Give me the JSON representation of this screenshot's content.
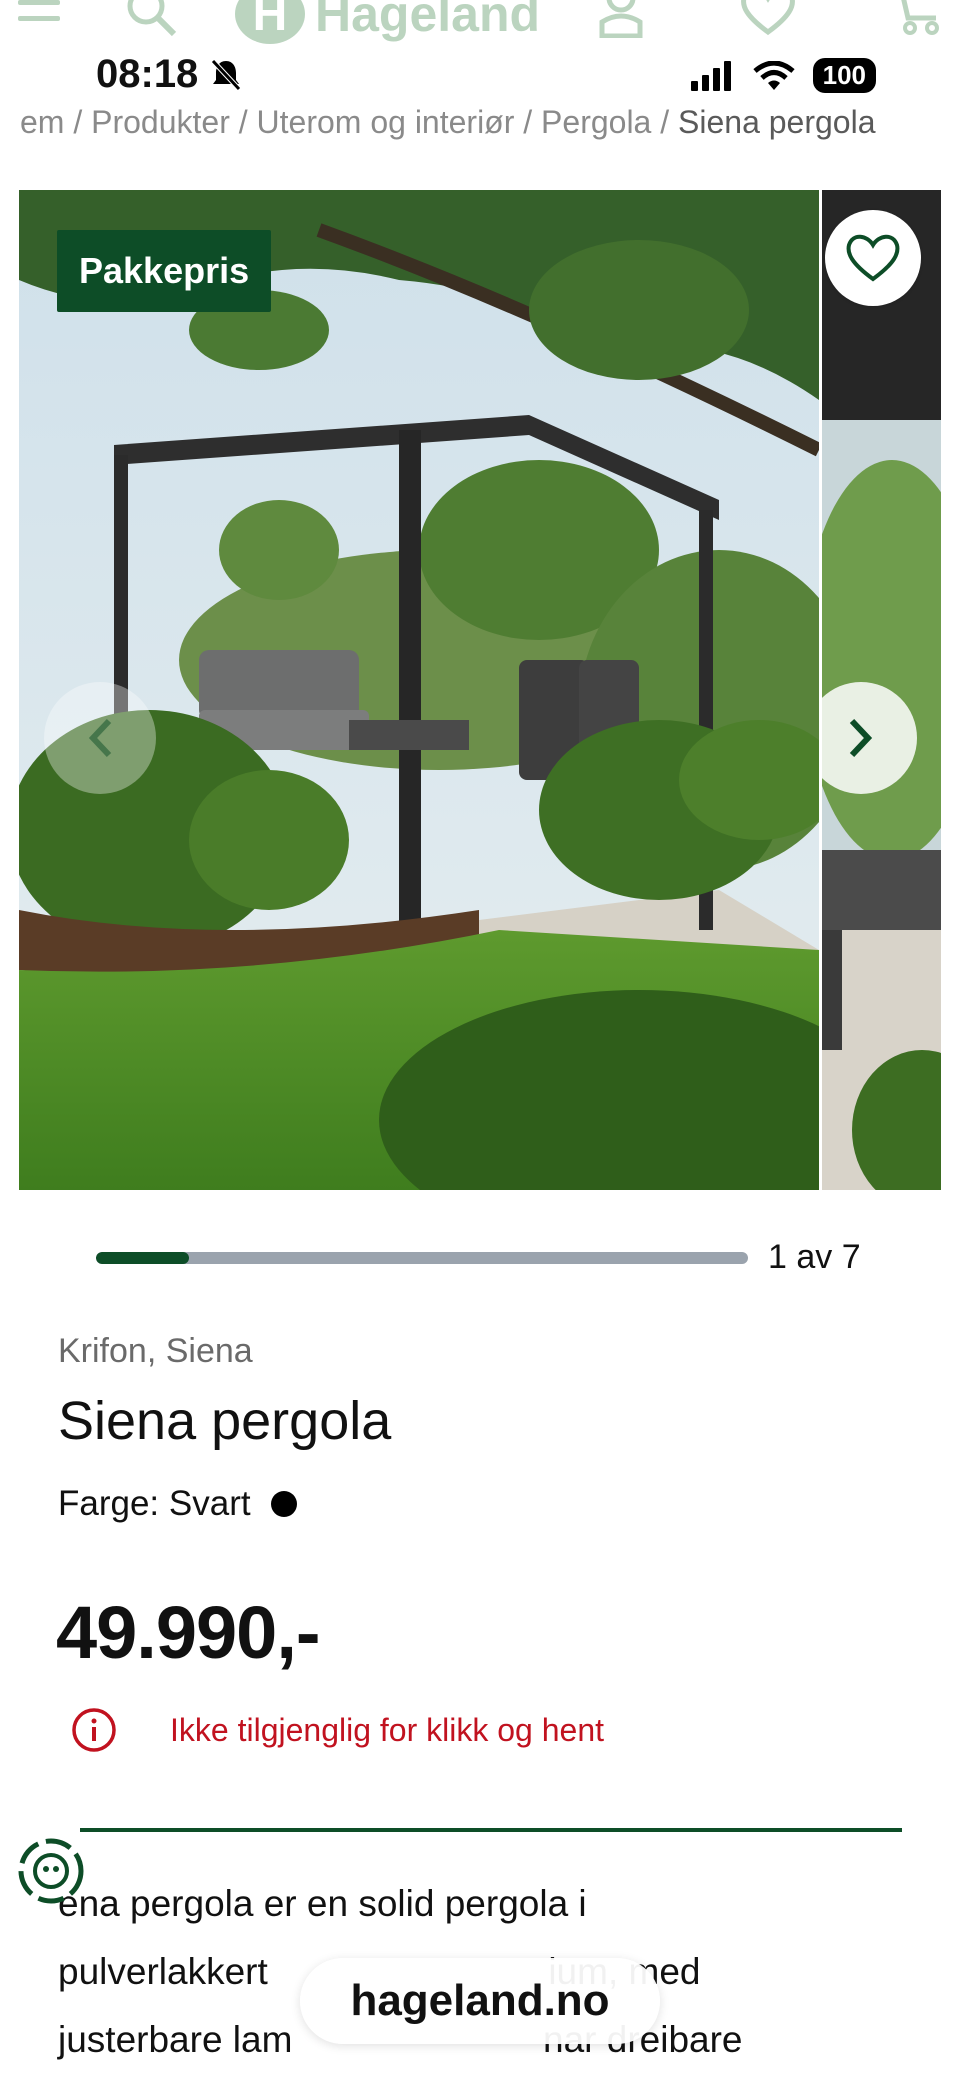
{
  "header": {
    "brand": "Hageland",
    "icons": [
      "menu-icon",
      "search-icon",
      "user-icon",
      "heart-icon",
      "cart-icon"
    ]
  },
  "status_bar": {
    "time": "08:18",
    "battery": "100"
  },
  "breadcrumb": {
    "items": [
      "em",
      "Produkter",
      "Uterom og interiør",
      "Pergola"
    ],
    "current": "Siena pergola"
  },
  "gallery": {
    "badge": "Pakkepris",
    "current_index": 1,
    "total": 7,
    "counter_text": "1 av 7",
    "progress_fraction": 0.143
  },
  "product": {
    "brand": "Krifon, Siena",
    "title": "Siena pergola",
    "color_label": "Farge: Svart",
    "color_hex": "#000000",
    "price": "49.990,-",
    "availability": "Ikke tilgjenglig for klikk og hent"
  },
  "description": {
    "line1": "ena pergola er en solid pergola i",
    "line2_a": "pulverlakkert",
    "line2_b": "ium, med",
    "line3_a": "justerbare lam",
    "line3_b": "nar dreibare"
  },
  "footer": {
    "site": "hageland.no"
  },
  "colors": {
    "brand_green": "#0d4d27",
    "alert_red": "#c1121f",
    "progress_track": "#9aa3ad"
  }
}
